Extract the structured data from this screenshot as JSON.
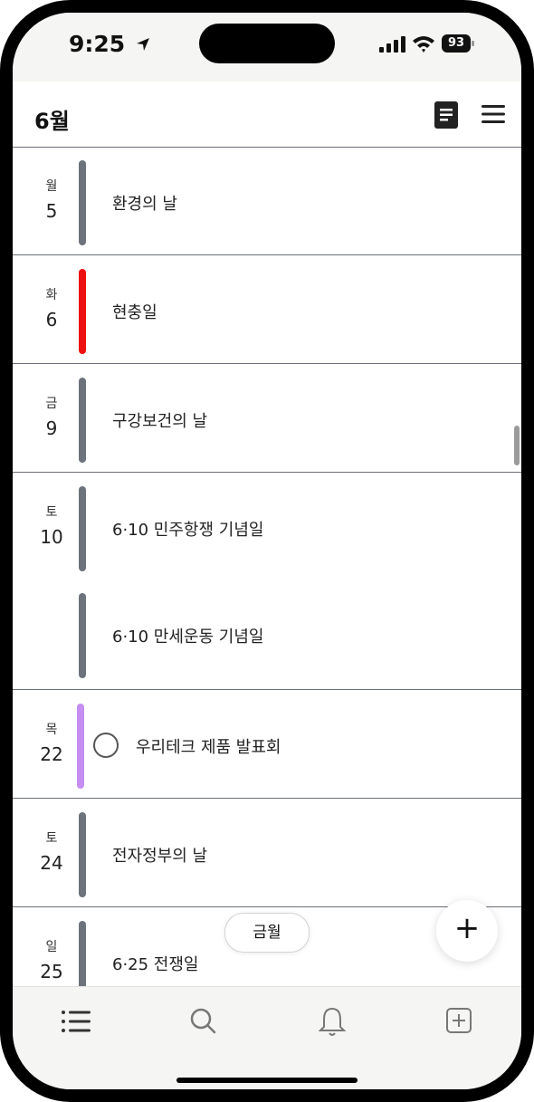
{
  "status_bar": {
    "time": "9:25",
    "battery": "93"
  },
  "header": {
    "month": "6월"
  },
  "events": [
    {
      "weekday": "월",
      "day": "5",
      "title": "환경의 날",
      "color": "#6d737c",
      "task": false
    },
    {
      "weekday": "화",
      "day": "6",
      "title": "현충일",
      "color": "#ee1111",
      "task": false
    },
    {
      "weekday": "금",
      "day": "9",
      "title": "구강보건의 날",
      "color": "#6d737c",
      "task": false
    },
    {
      "weekday": "토",
      "day": "10",
      "title": "6·10 민주항쟁 기념일",
      "color": "#6d737c",
      "task": false
    },
    {
      "weekday": "",
      "day": "",
      "title": "6·10 만세운동 기념일",
      "color": "#6d737c",
      "task": false
    },
    {
      "weekday": "목",
      "day": "22",
      "title": "우리테크 제품 발표회",
      "color": "#c68ef2",
      "task": true
    },
    {
      "weekday": "토",
      "day": "24",
      "title": "전자정부의 날",
      "color": "#6d737c",
      "task": false
    },
    {
      "weekday": "일",
      "day": "25",
      "title": "6·25 전쟁일",
      "color": "#6d737c",
      "task": false
    }
  ],
  "today_button": "금월",
  "fab_label": "+",
  "tabs": [
    {
      "name": "list-icon"
    },
    {
      "name": "search-icon"
    },
    {
      "name": "bell-icon"
    },
    {
      "name": "add-box-icon"
    }
  ]
}
